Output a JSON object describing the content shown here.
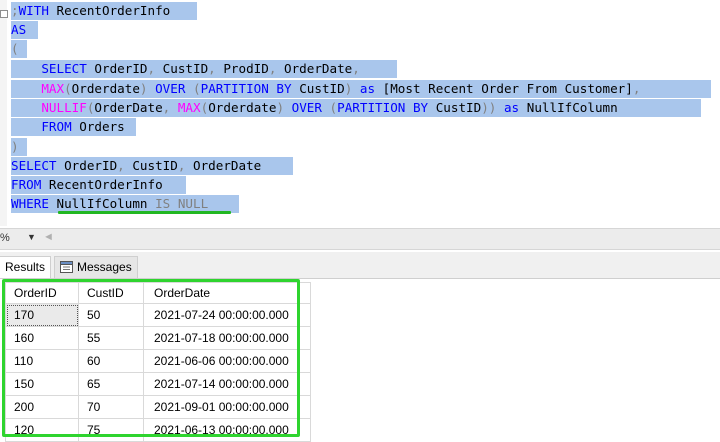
{
  "editor": {
    "lines": [
      [
        {
          "t": ";",
          "c": "gr"
        },
        {
          "t": "WITH",
          "c": "kw"
        },
        {
          "t": " RecentOrderInfo",
          "c": "tx"
        }
      ],
      [
        {
          "t": "AS",
          "c": "kw"
        }
      ],
      [
        {
          "t": "(",
          "c": "gr"
        }
      ],
      [
        {
          "t": "    SELECT",
          "c": "kw"
        },
        {
          "t": " OrderID",
          "c": "tx"
        },
        {
          "t": ",",
          "c": "gr"
        },
        {
          "t": " CustID",
          "c": "tx"
        },
        {
          "t": ",",
          "c": "gr"
        },
        {
          "t": " ProdID",
          "c": "tx"
        },
        {
          "t": ",",
          "c": "gr"
        },
        {
          "t": " OrderDate",
          "c": "tx"
        },
        {
          "t": ",",
          "c": "gr"
        }
      ],
      [
        {
          "t": "    MAX",
          "c": "fn"
        },
        {
          "t": "(",
          "c": "gr"
        },
        {
          "t": "Orderdate",
          "c": "tx"
        },
        {
          "t": ")",
          "c": "gr"
        },
        {
          "t": " OVER ",
          "c": "kw"
        },
        {
          "t": "(",
          "c": "gr"
        },
        {
          "t": "PARTITION BY",
          "c": "kw"
        },
        {
          "t": " CustID",
          "c": "tx"
        },
        {
          "t": ")",
          "c": "gr"
        },
        {
          "t": " as ",
          "c": "kw"
        },
        {
          "t": "[Most Recent Order From Customer]",
          "c": "tx"
        },
        {
          "t": ",",
          "c": "gr"
        }
      ],
      [
        {
          "t": "    NULLIF",
          "c": "fn"
        },
        {
          "t": "(",
          "c": "gr"
        },
        {
          "t": "OrderDate",
          "c": "tx"
        },
        {
          "t": ",",
          "c": "gr"
        },
        {
          "t": " MAX",
          "c": "fn"
        },
        {
          "t": "(",
          "c": "gr"
        },
        {
          "t": "Orderdate",
          "c": "tx"
        },
        {
          "t": ")",
          "c": "gr"
        },
        {
          "t": " OVER ",
          "c": "kw"
        },
        {
          "t": "(",
          "c": "gr"
        },
        {
          "t": "PARTITION BY",
          "c": "kw"
        },
        {
          "t": " CustID",
          "c": "tx"
        },
        {
          "t": "))",
          "c": "gr"
        },
        {
          "t": " as ",
          "c": "kw"
        },
        {
          "t": "NullIfColumn",
          "c": "tx"
        }
      ],
      [
        {
          "t": "    FROM",
          "c": "kw"
        },
        {
          "t": " Orders",
          "c": "tx"
        }
      ],
      [
        {
          "t": ")",
          "c": "gr"
        }
      ],
      [
        {
          "t": "SELECT",
          "c": "kw"
        },
        {
          "t": " OrderID",
          "c": "tx"
        },
        {
          "t": ",",
          "c": "gr"
        },
        {
          "t": " CustID",
          "c": "tx"
        },
        {
          "t": ",",
          "c": "gr"
        },
        {
          "t": " OrderDate",
          "c": "tx"
        }
      ],
      [
        {
          "t": "FROM",
          "c": "kw"
        },
        {
          "t": " RecentOrderInfo",
          "c": "tx"
        }
      ],
      [
        {
          "t": "WHERE",
          "c": "kw"
        },
        {
          "t": " NullIfColumn ",
          "c": "tx"
        },
        {
          "t": "IS NULL",
          "c": "gr"
        }
      ]
    ]
  },
  "statusbar": {
    "zoom_label": "%",
    "zoom_arrow": "▼",
    "scroll_left": "◄"
  },
  "tabs": {
    "results_label": "Results",
    "messages_label": "Messages"
  },
  "grid": {
    "headers": [
      "OrderID",
      "CustID",
      "OrderDate"
    ],
    "rows": [
      [
        "170",
        "50",
        "2021-07-24 00:00:00.000"
      ],
      [
        "160",
        "55",
        "2021-07-18 00:00:00.000"
      ],
      [
        "110",
        "60",
        "2021-06-06 00:00:00.000"
      ],
      [
        "150",
        "65",
        "2021-07-14 00:00:00.000"
      ],
      [
        "200",
        "70",
        "2021-09-01 00:00:00.000"
      ],
      [
        "120",
        "75",
        "2021-06-13 00:00:00.000"
      ]
    ]
  },
  "colors": {
    "keyword": "#0000ff",
    "function": "#ff00ff",
    "operator": "#808080",
    "selection": "#a9c6ec",
    "highlight_outline": "#2fd42f"
  }
}
